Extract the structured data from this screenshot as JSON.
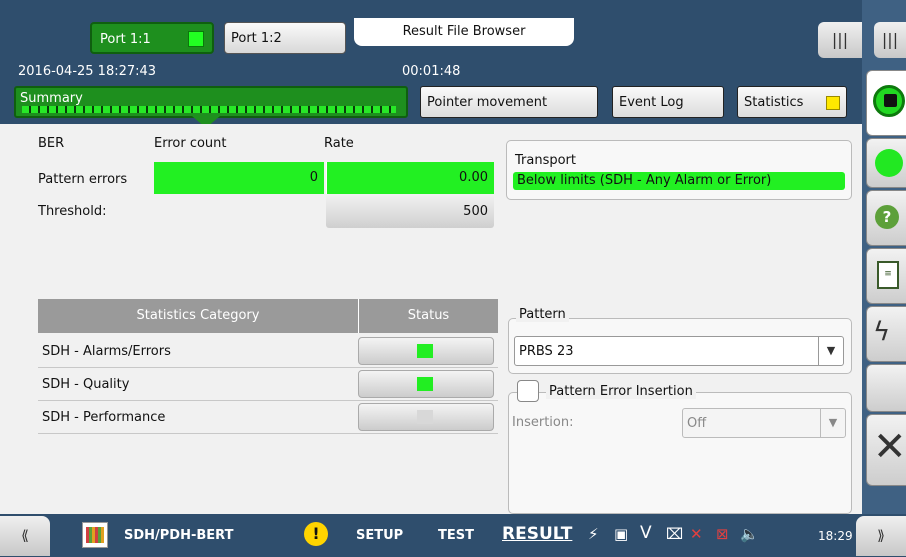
{
  "header": {
    "ports": [
      {
        "label": "Port 1:1",
        "active": true,
        "led_color": "#22ff22"
      },
      {
        "label": "Port 1:2",
        "active": false
      }
    ],
    "result_file_browser": "Result File Browser",
    "datetime": "2016-04-25 18:27:43",
    "elapsed": "00:01:48",
    "menu_icon": "|||"
  },
  "tabs": {
    "summary": "Summary",
    "pointer": "Pointer movement",
    "eventlog": "Event Log",
    "statistics": "Statistics",
    "statistics_led_color": "#ffe800"
  },
  "ber": {
    "title": "BER",
    "error_count_label": "Error count",
    "rate_label": "Rate",
    "pattern_errors_label": "Pattern errors",
    "pattern_errors_count": "0",
    "pattern_errors_rate": "0.00",
    "threshold_label": "Threshold:",
    "threshold_value": "500"
  },
  "transport": {
    "title": "Transport",
    "status": "Below limits (SDH - Any Alarm or Error)"
  },
  "stats_table": {
    "col_category": "Statistics Category",
    "col_status": "Status",
    "rows": [
      {
        "name": "SDH - Alarms/Errors",
        "led_color": "#22ee22"
      },
      {
        "name": "SDH - Quality",
        "led_color": "#22ee22"
      },
      {
        "name": "SDH - Performance",
        "led_color": "#d8d8d8"
      }
    ]
  },
  "pattern": {
    "group_label": "Pattern",
    "selected": "PRBS 23",
    "arrow": "▼"
  },
  "pattern_error_insertion": {
    "label": "Pattern Error Insertion",
    "checked": false,
    "insertion_label": "Insertion:",
    "insertion_value": "Off",
    "arrow": "▼"
  },
  "side_panel": {
    "menu_icon": "|||",
    "help": "?",
    "exit": "✕"
  },
  "bottom_bar": {
    "nav_left": "⟪",
    "nav_right": "⟫",
    "app_name": "SDH/PDH-BERT",
    "warning": "!",
    "setup": "SETUP",
    "test": "TEST",
    "result": "RESULT",
    "v_icon": "V",
    "clock": "18:29"
  }
}
